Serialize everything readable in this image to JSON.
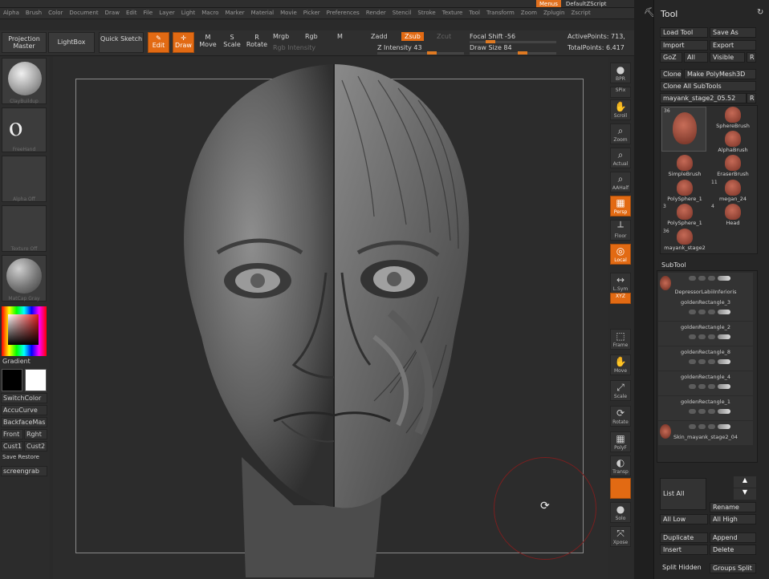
{
  "app": {
    "menus_button": "Menus",
    "default_script": "DefaultZScript"
  },
  "menubar": [
    "Alpha",
    "Brush",
    "Color",
    "Document",
    "Draw",
    "Edit",
    "File",
    "Layer",
    "Light",
    "Macro",
    "Marker",
    "Material",
    "Movie",
    "Picker",
    "Preferences",
    "Render",
    "Stencil",
    "Stroke",
    "Texture",
    "Tool",
    "Transform",
    "Zoom",
    "Zplugin",
    "Zscript"
  ],
  "toolbar": {
    "projection_master": "Projection Master",
    "lightbox": "LightBox",
    "quick_sketch": "Quick Sketch",
    "edit": "Edit",
    "draw": "Draw",
    "move": "Move",
    "scale": "Scale",
    "rotate": "Rotate",
    "mrgb": "Mrgb",
    "rgb": "Rgb",
    "m": "M",
    "rgb_intensity": "Rgb Intensity",
    "zadd": "Zadd",
    "zsub": "Zsub",
    "zcut": "Zcut",
    "z_intensity": "Z Intensity 43",
    "focal_shift": "Focal Shift -56",
    "draw_size": "Draw Size 84",
    "active_points": "ActivePoints: 713,",
    "total_points": "TotalPoints: 6.417"
  },
  "left": {
    "brush_caption": "ClayBuildup",
    "stroke_caption": "FreeHand",
    "alpha_caption": "Alpha Off",
    "texture_caption": "Texture Off",
    "material_caption": "MatCap Gray",
    "gradient": "Gradient",
    "switch_color": "SwitchColor",
    "accucurve": "AccuCurve",
    "backface": "BackfaceMas",
    "front": "Front",
    "right": "Rght",
    "cust1": "Cust1",
    "cust2": "Cust2",
    "save_restore": "Save Restore",
    "screengrab": "screengrab"
  },
  "icons": [
    {
      "name": "bpr",
      "glyph": "●",
      "label": "BPR",
      "active": false
    },
    {
      "name": "spix",
      "glyph": "",
      "label": "SPix",
      "active": false
    },
    {
      "name": "scroll",
      "glyph": "✋",
      "label": "Scroll",
      "active": false
    },
    {
      "name": "zoom",
      "glyph": "⌕",
      "label": "Zoom",
      "active": false
    },
    {
      "name": "actual",
      "glyph": "⌕",
      "label": "Actual",
      "active": false
    },
    {
      "name": "aahalf",
      "glyph": "⌕",
      "label": "AAHalf",
      "active": false
    },
    {
      "name": "persp",
      "glyph": "▦",
      "label": "Persp",
      "active": true
    },
    {
      "name": "floor",
      "glyph": "┴",
      "label": "Floor",
      "active": false
    },
    {
      "name": "local",
      "glyph": "◎",
      "label": "Local",
      "active": true
    },
    {
      "name": "lsym",
      "glyph": "↔",
      "label": "L.Sym",
      "active": false
    },
    {
      "name": "xyz",
      "glyph": "",
      "label": "XYZ",
      "active": true
    },
    {
      "name": "frame",
      "glyph": "⬚",
      "label": "Frame",
      "active": false
    },
    {
      "name": "move",
      "glyph": "✋",
      "label": "Move",
      "active": false
    },
    {
      "name": "scale",
      "glyph": "⤢",
      "label": "Scale",
      "active": false
    },
    {
      "name": "rotate",
      "glyph": "⟳",
      "label": "Rotate",
      "active": false
    },
    {
      "name": "polyf",
      "glyph": "▦",
      "label": "PolyF",
      "active": false
    },
    {
      "name": "transp",
      "glyph": "◐",
      "label": "Transp",
      "active": false
    },
    {
      "name": "ghost",
      "glyph": "",
      "label": "",
      "active": true
    },
    {
      "name": "solo",
      "glyph": "●",
      "label": "Solo",
      "active": false
    },
    {
      "name": "xpose",
      "glyph": "⤧",
      "label": "Xpose",
      "active": false
    }
  ],
  "tool_panel": {
    "title": "Tool",
    "load_tool": "Load Tool",
    "save_as": "Save As",
    "import": "Import",
    "export": "Export",
    "goz": "GoZ",
    "all": "All",
    "visible": "Visible",
    "r": "R",
    "clone": "Clone",
    "make_polymesh": "Make PolyMesh3D",
    "clone_all": "Clone All SubTools",
    "current_tool": "mayank_stage2_05.52",
    "current_count": "36",
    "tools": [
      {
        "name": "SphereBrush",
        "count": ""
      },
      {
        "name": "AlphaBrush",
        "count": ""
      },
      {
        "name": "SimpleBrush",
        "count": ""
      },
      {
        "name": "EraserBrush",
        "count": ""
      },
      {
        "name": "PolySphere_1",
        "count": ""
      },
      {
        "name": "megan_24",
        "count": "11"
      },
      {
        "name": "PolySphere_1",
        "count": "3"
      },
      {
        "name": "Head",
        "count": "4"
      },
      {
        "name": "mayank_stage2",
        "count": "36"
      }
    ],
    "subtool": "SubTool",
    "subtools": [
      "DepressorLabiiInferioris",
      "goldenRectangle_3",
      "goldenRectangle_2",
      "goldenRectangle_8",
      "goldenRectangle_4",
      "goldenRectangle_1",
      "Skin_mayank_stage2_04"
    ],
    "list_all": "List All",
    "rename": "Rename",
    "all_low": "All Low",
    "all_high": "All High",
    "duplicate": "Duplicate",
    "append": "Append",
    "insert": "Insert",
    "delete": "Delete",
    "split_hidden": "Split Hidden",
    "groups_split": "Groups Split"
  },
  "colors": {
    "accent": "#e26a13",
    "panel": "#2c2c2c",
    "canvas": "#2c2c2c"
  }
}
